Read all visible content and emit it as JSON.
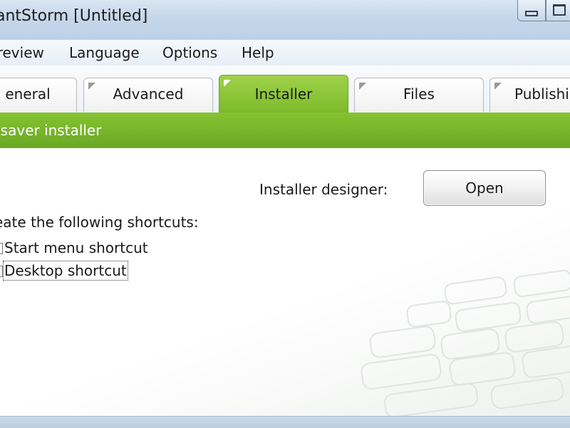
{
  "window": {
    "title": "antStorm [Untitled]"
  },
  "menu": {
    "items": [
      "Preview",
      "Language",
      "Options",
      "Help"
    ]
  },
  "tabs": [
    {
      "label": "eneral"
    },
    {
      "label": "Advanced"
    },
    {
      "label": "Installer",
      "active": true
    },
    {
      "label": "Files"
    },
    {
      "label": "Publishi"
    }
  ],
  "section": {
    "header": "nsaver installer"
  },
  "installer": {
    "designer_label": "Installer designer:",
    "open_button": "Open",
    "shortcuts_label": "eate the following shortcuts:",
    "shortcuts": [
      {
        "label": "Start menu shortcut",
        "checked": false
      },
      {
        "label": "Desktop shortcut",
        "checked": false,
        "focused": true
      }
    ]
  },
  "colors": {
    "accent_green": "#7cba2a",
    "titlebar_blue": "#c6d7ea"
  }
}
